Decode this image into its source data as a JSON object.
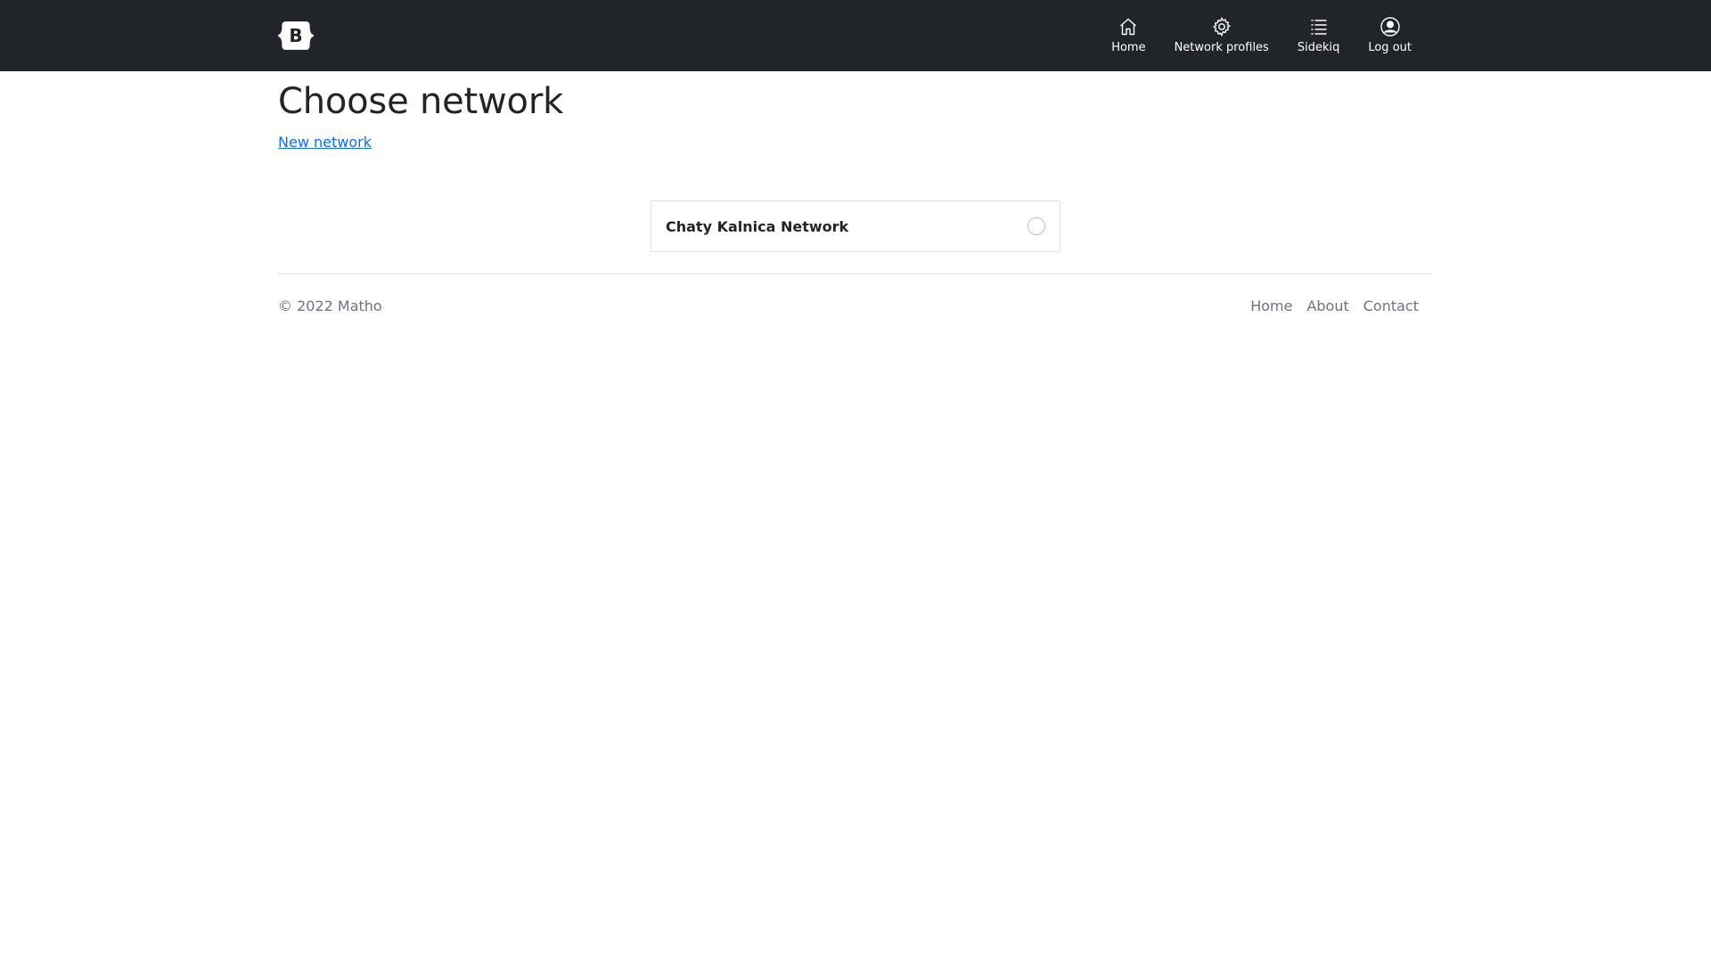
{
  "navbar": {
    "brand_letter": "B",
    "brand_icon": "bootstrap-logo-icon",
    "items": [
      {
        "label": "Home",
        "icon": "house-icon"
      },
      {
        "label": "Network profiles",
        "icon": "gear-icon"
      },
      {
        "label": "Sidekiq",
        "icon": "list-icon"
      },
      {
        "label": "Log out",
        "icon": "person-circle-icon"
      }
    ]
  },
  "main": {
    "title": "Choose network",
    "new_link": "New network",
    "networks": [
      {
        "name": "Chaty Kalnica Network",
        "selected": false
      }
    ]
  },
  "footer": {
    "copyright": "© 2022 Matho",
    "links": [
      "Home",
      "About",
      "Contact"
    ]
  },
  "colors": {
    "navbar_bg": "#212529",
    "link": "#0d6efd",
    "muted": "#6c757d",
    "border": "#dee2e6"
  }
}
